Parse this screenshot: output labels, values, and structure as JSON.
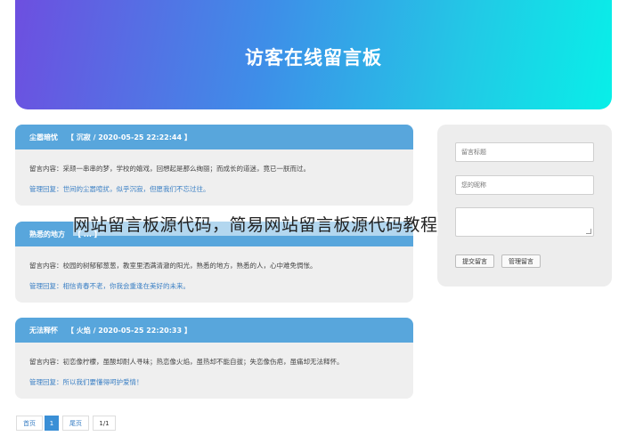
{
  "banner": {
    "title": "访客在线留言板"
  },
  "messages": [
    {
      "name": "尘嚣暗忧",
      "meta": "【 沉寂 / 2020-05-25 22:22:44 】",
      "content": "留言内容：采颉一串串的梦，学校的嬉戏，回想起是那么绚丽；而成长的道迷，竟已一朕而过。",
      "reply": "管理回复：世间的尘嚣喧扰，似乎沉寂，但愿我们不忘过往。"
    },
    {
      "name": "熟悉的地方",
      "meta": "【 ... 】",
      "content": "留言内容：校园的树郁郁葱葱，教室里洒满清澈的阳光，熟悉的地方，熟悉的人，心中难免惆怅。",
      "reply": "管理回复：相信青春不老，你我会重逢在美好的未来。"
    },
    {
      "name": "无法释怀",
      "meta": "【 火焰 / 2020-05-25 22:20:33 】",
      "content": "留言内容：初恋像柠檬，虽酸却耐人寻味；热恋像火焰，虽热却不能自拔；失恋像伤疤，虽痛却无法释怀。",
      "reply": "管理回复：所以我们要懂得呵护爱情！"
    }
  ],
  "form": {
    "title_placeholder": "留言标题",
    "name_placeholder": "您的昵称",
    "submit_label": "提交留言",
    "manage_label": "管理留言"
  },
  "pagination": {
    "first": "首页",
    "current": "1",
    "last": "尾页",
    "info": "1/1"
  },
  "watermark": "网站留言板源代码，简易网站留言板源代码教程"
}
